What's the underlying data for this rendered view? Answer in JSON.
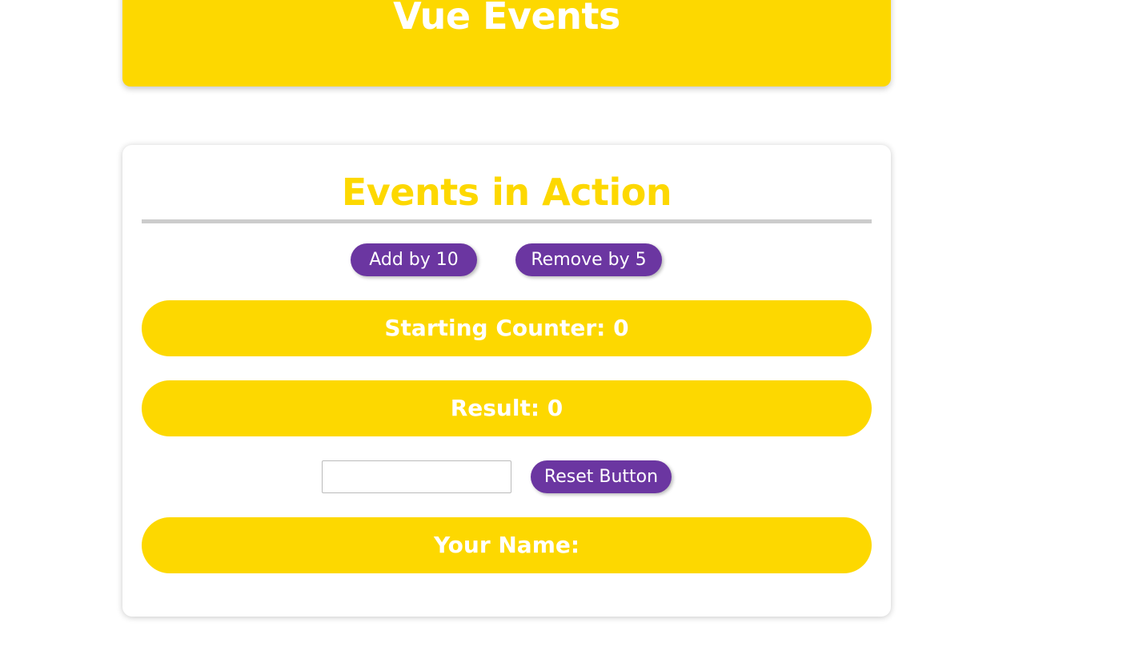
{
  "header": {
    "title": "Vue Events"
  },
  "main": {
    "title": "Events in Action",
    "buttons": {
      "add_label": "Add by 10",
      "remove_label": "Remove by 5",
      "reset_label": "Reset Button"
    },
    "starting_counter_text": "Starting Counter: 0",
    "result_text": "Result: 0",
    "name_input": {
      "value": "",
      "placeholder": ""
    },
    "your_name_text": "Your Name:"
  },
  "colors": {
    "accent_yellow": "#fdd800",
    "button_purple": "#6b36a1",
    "divider_gray": "#cccccc",
    "text_white": "#ffffff"
  }
}
